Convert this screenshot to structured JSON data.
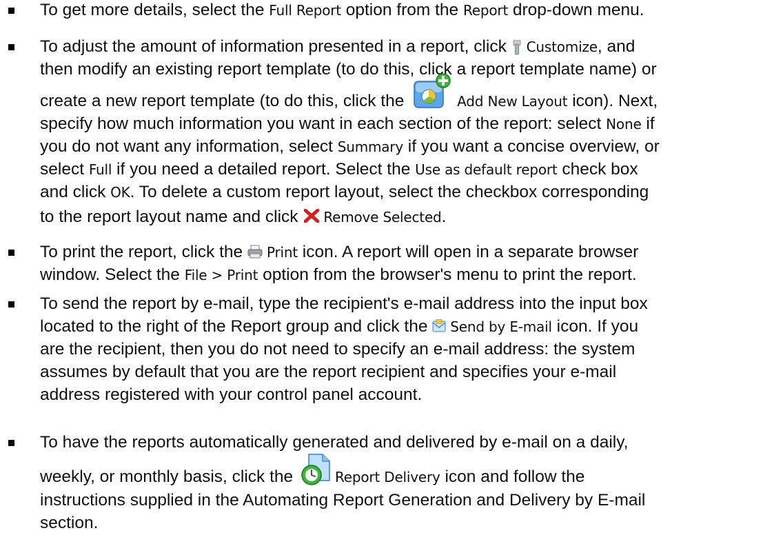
{
  "items": [
    {
      "line1": {
        "a": "To get more details, select the ",
        "b": "Full Report",
        "c": " option from the ",
        "d": "Report",
        "e": " drop-down menu."
      }
    },
    {
      "line1": {
        "a": "To adjust the amount of information presented in a report, click ",
        "b": "Customize",
        "c": ", and"
      },
      "line2": "then modify an existing report template (to do this, click a report template name) or",
      "line3": {
        "a": "create a new report template (to do this, click the ",
        "b": "Add New Layout",
        "c": " icon). Next,"
      },
      "line4": {
        "a": "specify how much information you want in each section of the report: select ",
        "b": "None",
        "c": " if"
      },
      "line5": {
        "a": "you do not want any information, select ",
        "b": "Summary",
        "c": " if you want a concise overview, or"
      },
      "line6": {
        "a": "select ",
        "b": "Full",
        "c": " if you need a detailed report. Select the ",
        "d": "Use as default report",
        "e": " check box"
      },
      "line7": {
        "a": "and click ",
        "b": "OK",
        "c": ". To delete a custom report layout, select the checkbox corresponding"
      },
      "line8": {
        "a": "to the report layout name and click ",
        "b": "Remove Selected",
        "c": "."
      }
    },
    {
      "line1": {
        "a": "To print the report, click the ",
        "b": "Print",
        "c": " icon. A report will open in a separate browser"
      },
      "line2": {
        "a": "window. Select the ",
        "b": "File > Print",
        "c": " option from the browser's menu to print the report."
      }
    },
    {
      "line1": "To send the report by e-mail, type the recipient's e-mail address into the input box",
      "line2": {
        "a": "located to the right of the Report group and click the ",
        "b": "Send by E-mail",
        "c": " icon. If you"
      },
      "line3": "are the recipient, then you do not need to specify an e-mail address: the system",
      "line4": "assumes by default that you are the report recipient and specifies your e-mail",
      "line5": "address registered with your control panel account."
    },
    {
      "line1": "To have the reports automatically generated and delivered by e-mail on a daily,",
      "line2": {
        "a": "weekly, or monthly basis, click the ",
        "b": "Report Delivery",
        "c": " icon and follow the"
      },
      "line3": "instructions supplied in the Automating Report Generation and Delivery by E-mail",
      "line4": "section."
    }
  ],
  "icons": {
    "customize": "customize-icon",
    "add_new_layout": "add-new-layout-icon",
    "remove_selected": "remove-icon",
    "print": "print-icon",
    "send_by_email": "send-by-email-icon",
    "report_delivery": "report-delivery-icon"
  },
  "colors": {
    "text": "#111111",
    "remove_red": "#d42020",
    "add_green": "#3bb83b",
    "icon_blue": "#2f7fd6"
  }
}
